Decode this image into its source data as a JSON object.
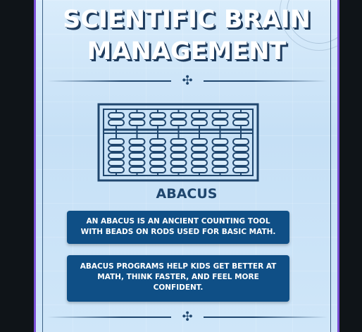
{
  "poster": {
    "title_line1": "SCIENTIFIC BRAIN",
    "title_line2": "MANAGEMENT",
    "section_label": "ABACUS",
    "info_box_1": "AN ABACUS IS AN ANCIENT COUNTING TOOL WITH BEADS ON RODS USED FOR BASIC MATH.",
    "info_box_2": "ABACUS PROGRAMS HELP KIDS GET BETTER AT MATH, THINK FASTER, AND FEEL MORE CONFIDENT."
  },
  "icons": {
    "divider_ornament": "fleuron-icon",
    "main_icon": "abacus-icon"
  },
  "colors": {
    "accent_dark_blue": "#1f466e",
    "box_blue": "#0f4f86",
    "frame_purple": "#7a4fd6",
    "poster_background": "#cfe6f9"
  }
}
